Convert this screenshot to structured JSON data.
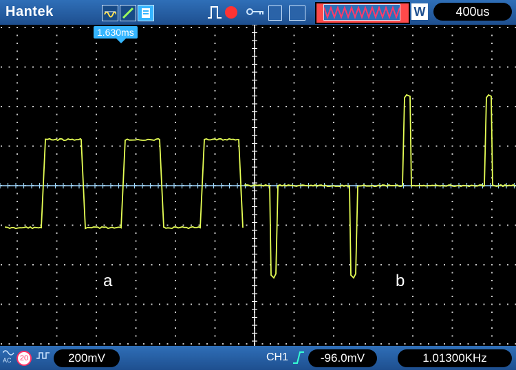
{
  "header": {
    "brand": "Hantek",
    "timebase": "400us",
    "window_mode_label": "W",
    "icons": [
      "waveform-mode-icon",
      "slope-icon",
      "autoset-icon",
      "pulse-icon",
      "record-icon",
      "key-icon",
      "save-disk-icon",
      "print-icon",
      "waveform-overview-icon"
    ]
  },
  "screen": {
    "cursor_time": "1.630ms",
    "trace_labels": {
      "a": "a",
      "b": "b"
    },
    "colors": {
      "trace": "#e6ff55",
      "grid": "#c8c8c8",
      "axis": "#ffffff",
      "cursor": "#35b6ff"
    }
  },
  "footer": {
    "coupling": "AC",
    "bandwidth": "20",
    "volt_div": "200mV",
    "channel": "CH1",
    "trigger_level": "-96.0mV",
    "frequency": "1.01300KHz"
  }
}
